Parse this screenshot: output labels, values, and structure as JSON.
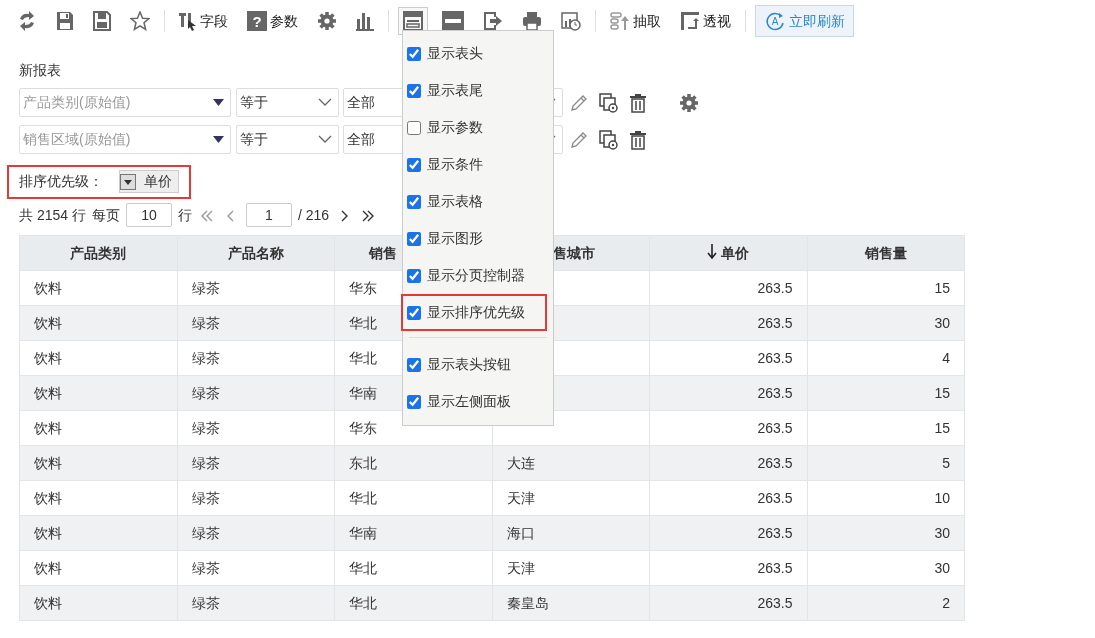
{
  "toolbar": {
    "field_label": "字段",
    "param_label": "参数",
    "extract_label": "抽取",
    "pivot_label": "透视",
    "refresh_label": "立即刷新",
    "param_icon_text": "?",
    "refresh_icon_text": "A",
    "layout_expanded": true
  },
  "report_title": "新报表",
  "filters": [
    {
      "field": "产品类别(原始值)",
      "operator": "等于",
      "value": "全部",
      "has_settings": true
    },
    {
      "field": "销售区域(原始值)",
      "operator": "等于",
      "value": "全部",
      "has_settings": false
    }
  ],
  "sort_priority": {
    "label": "排序优先级：",
    "items": [
      {
        "label": "单价"
      }
    ]
  },
  "pagination": {
    "total": "共 2154 行",
    "per_page_label": "每页",
    "per_page": "10",
    "rows_label": "行",
    "page": "1",
    "pages": "/ 216"
  },
  "table": {
    "columns": [
      {
        "label": "产品类别"
      },
      {
        "label": "产品名称"
      },
      {
        "label": "销售"
      },
      {
        "label": "售城市"
      },
      {
        "label": "单价",
        "sorted": true
      },
      {
        "label": "销售量"
      }
    ],
    "rows": [
      {
        "category": "饮料",
        "product": "绿茶",
        "region": "华东",
        "price": "263.5",
        "quantity": "15"
      },
      {
        "category": "饮料",
        "product": "绿茶",
        "region": "华北",
        "price": "263.5",
        "quantity": "30"
      },
      {
        "category": "饮料",
        "product": "绿茶",
        "region": "华北",
        "price": "263.5",
        "quantity": "4"
      },
      {
        "category": "饮料",
        "product": "绿茶",
        "region": "华南",
        "price": "263.5",
        "quantity": "15"
      },
      {
        "category": "饮料",
        "product": "绿茶",
        "region": "华东",
        "price": "263.5",
        "quantity": "15"
      },
      {
        "category": "饮料",
        "product": "绿茶",
        "region": "东北",
        "city": "大连",
        "price": "263.5",
        "quantity": "5"
      },
      {
        "category": "饮料",
        "product": "绿茶",
        "region": "华北",
        "city": "天津",
        "price": "263.5",
        "quantity": "10"
      },
      {
        "category": "饮料",
        "product": "绿茶",
        "region": "华南",
        "city": "海口",
        "price": "263.5",
        "quantity": "30"
      },
      {
        "category": "饮料",
        "product": "绿茶",
        "region": "华北",
        "city": "天津",
        "price": "263.5",
        "quantity": "30"
      },
      {
        "category": "饮料",
        "product": "绿茶",
        "region": "华北",
        "city": "秦皇岛",
        "price": "263.5",
        "quantity": "2"
      }
    ]
  },
  "display_menu": {
    "groups": [
      [
        {
          "label": "显示表头",
          "checked": true,
          "highlighted": false
        },
        {
          "label": "显示表尾",
          "checked": true,
          "highlighted": false
        },
        {
          "label": "显示参数",
          "checked": false,
          "highlighted": false
        },
        {
          "label": "显示条件",
          "checked": true,
          "highlighted": false
        },
        {
          "label": "显示表格",
          "checked": true,
          "highlighted": false
        },
        {
          "label": "显示图形",
          "checked": true,
          "highlighted": false
        },
        {
          "label": "显示分页控制器",
          "checked": true,
          "highlighted": false
        },
        {
          "label": "显示排序优先级",
          "checked": true,
          "highlighted": true
        }
      ],
      [
        {
          "label": "显示表头按钮",
          "checked": true,
          "highlighted": false
        },
        {
          "label": "显示左侧面板",
          "checked": true,
          "highlighted": false
        }
      ]
    ]
  }
}
